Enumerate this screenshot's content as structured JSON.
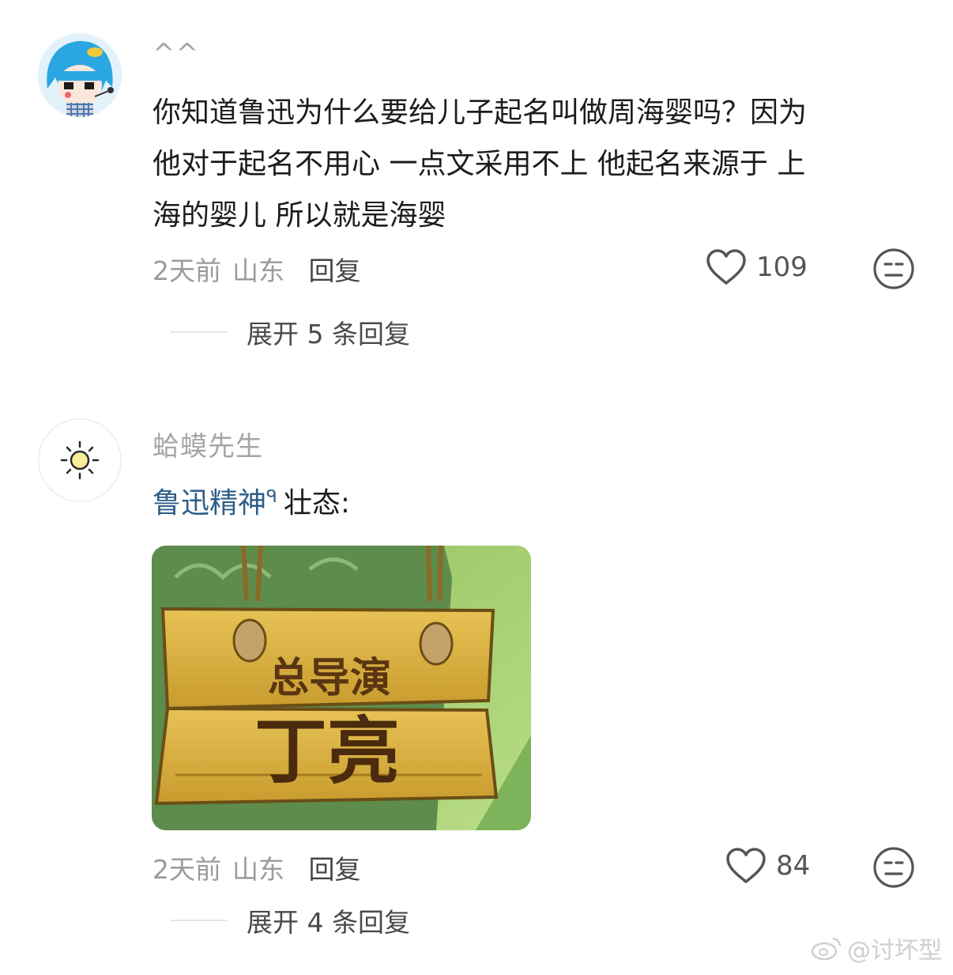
{
  "comments": [
    {
      "username": "^^",
      "text_lines": [
        "你知道鲁迅为什么要给儿子起名叫做周海婴吗？因为",
        "他对于起名不用心 一点文采用不上 他起名来源于 上",
        "海的婴儿 所以就是海婴"
      ],
      "time": "2天前",
      "location": "山东",
      "reply_label": "回复",
      "likes": "109",
      "expand_label": "展开 5 条回复"
    },
    {
      "username": "蛤蟆先生",
      "highlight_text": "鲁迅精神",
      "search_mark": "ᑫ",
      "text_after": "壮态:",
      "image": {
        "sign_top": "总导演",
        "sign_bottom": "丁亮"
      },
      "time": "2天前",
      "location": "山东",
      "reply_label": "回复",
      "likes": "84",
      "expand_label": "展开 4 条回复"
    }
  ],
  "watermark": "@讨坏型",
  "icons": {
    "like": "heart-outline-icon",
    "dislike": "meh-face-icon",
    "sun": "sun-icon",
    "weibo": "weibo-logo-icon"
  },
  "colors": {
    "highlight": "#2d5e88",
    "meta": "#9b9b9b",
    "username": "#a6a6a6"
  }
}
